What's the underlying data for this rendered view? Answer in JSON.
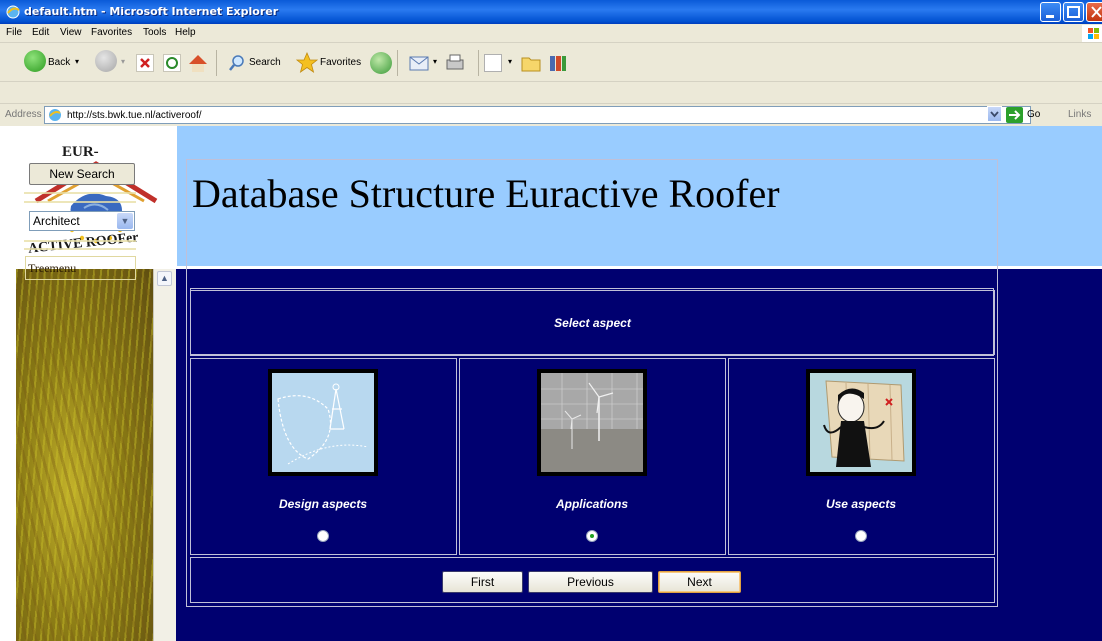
{
  "window": {
    "title": "default.htm - Microsoft Internet Explorer"
  },
  "menu": [
    "File",
    "Edit",
    "View",
    "Favorites",
    "Tools",
    "Help"
  ],
  "toolbar": {
    "back_label": "Back",
    "search_label": "Search",
    "favorites_label": "Favorites"
  },
  "address": {
    "label": "Address",
    "url": "http://sts.bwk.tue.nl/activeroof/",
    "go_label": "Go",
    "links_label": "Links"
  },
  "page": {
    "title": "Database Structure Euractive Roofer",
    "logo_top": "EUR-",
    "logo_bottom": "ACTIVE ROOFer"
  },
  "sidebar": {
    "new_search_label": "New Search",
    "role_selected": "Architect",
    "treemenu_label": "Treemenu"
  },
  "main": {
    "heading": "Select aspect",
    "aspects": [
      {
        "label": "Design aspects",
        "icon": "design-drawing-icon",
        "selected": false
      },
      {
        "label": "Applications",
        "icon": "wind-turbine-photo-icon",
        "selected": true
      },
      {
        "label": "Use aspects",
        "icon": "person-with-map-icon",
        "selected": false
      }
    ],
    "buttons": {
      "first": "First",
      "previous": "Previous",
      "next": "Next"
    }
  },
  "colors": {
    "title_bar": "#0a5ad8",
    "page_background": "#000070",
    "header_background": "#99ccff"
  }
}
